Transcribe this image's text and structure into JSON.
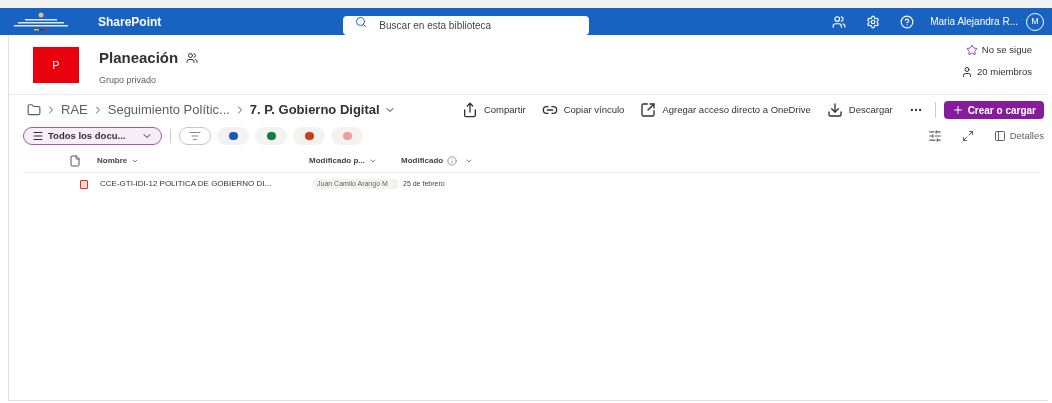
{
  "topbar": {
    "app": "SharePoint",
    "search": {
      "placeholder": "Buscar en esta biblioteca"
    },
    "user": "Maria Alejandra R...",
    "avatar": "M"
  },
  "site": {
    "initial": "P",
    "title": "Planeación",
    "subtitle": "Grupo privado",
    "follow": "No se sigue",
    "members": "20 miembros"
  },
  "breadcrumb": [
    "RAE",
    "Seguimiento Polític...",
    "7. P. Gobierno Digital"
  ],
  "commands": [
    {
      "kind": "share",
      "label": "Compartir"
    },
    {
      "kind": "link",
      "label": "Copiar vínculo"
    },
    {
      "kind": "shortcut",
      "label": "Agregar acceso directo a OneDrive"
    },
    {
      "kind": "download",
      "label": "Descargar"
    }
  ],
  "create_button": "Crear o cargar",
  "view": "Todos los docu...",
  "filter_pills": [
    {
      "kind": "filter"
    },
    {
      "kind": "word"
    },
    {
      "kind": "excel"
    },
    {
      "kind": "powerpoint"
    },
    {
      "kind": "pdf"
    }
  ],
  "details": "Detalles",
  "table": {
    "columns": [
      "Nombre",
      "Modificado p...",
      "Modificado"
    ],
    "rows": [
      {
        "name": "CCE-GTI-IDI-12 POLITICA DE GOBIERNO DI...",
        "modified_by": "Juan Camilo Arango M",
        "modified": "25 de febrero"
      }
    ]
  }
}
